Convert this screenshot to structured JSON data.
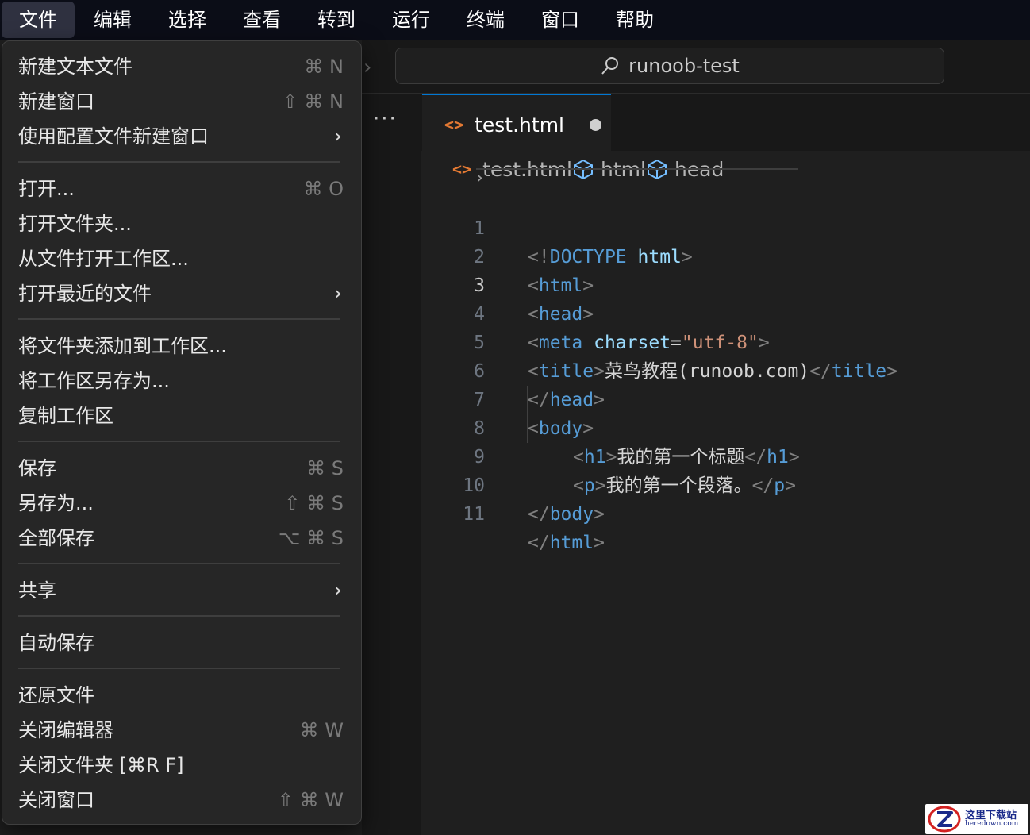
{
  "menubar": {
    "items": [
      "文件",
      "编辑",
      "选择",
      "查看",
      "转到",
      "运行",
      "终端",
      "窗口",
      "帮助"
    ]
  },
  "command_center": {
    "text": "runoob-test",
    "icon": "search-icon"
  },
  "more_actions": "···",
  "tab": {
    "label": "test.html",
    "dirty": true
  },
  "breadcrumb": {
    "file": "test.html",
    "node1": "html",
    "node2": "head"
  },
  "code": {
    "current_line": 3,
    "line_numbers": [
      "1",
      "2",
      "3",
      "4",
      "5",
      "6",
      "7",
      "8",
      "9",
      "10",
      "11"
    ],
    "tokens": {
      "lt": "<",
      "gt": ">",
      "close": "</",
      "bang": "!",
      "doctype": "DOCTYPE",
      "html": "html",
      "head": "head",
      "meta": "meta",
      "charset": "charset",
      "eq": "=",
      "charset_val": "\"utf-8\"",
      "title": "title",
      "title_text": "菜鸟教程(runoob.com)",
      "body": "body",
      "h1": "h1",
      "h1_text": "我的第一个标题",
      "p": "p",
      "p_text": "我的第一个段落。"
    }
  },
  "file_menu": {
    "new_text_file": "新建文本文件",
    "new_text_file_sc": "⌘ N",
    "new_window": "新建窗口",
    "new_window_sc": "⇧ ⌘ N",
    "new_window_profile": "使用配置文件新建窗口",
    "open": "打开...",
    "open_sc": "⌘ O",
    "open_folder": "打开文件夹...",
    "open_workspace": "从文件打开工作区...",
    "open_recent": "打开最近的文件",
    "add_folder": "将文件夹添加到工作区...",
    "save_workspace_as": "将工作区另存为...",
    "duplicate_workspace": "复制工作区",
    "save": "保存",
    "save_sc": "⌘ S",
    "save_as": "另存为...",
    "save_as_sc": "⇧ ⌘ S",
    "save_all": "全部保存",
    "save_all_sc": "⌥ ⌘ S",
    "share": "共享",
    "auto_save": "自动保存",
    "revert": "还原文件",
    "close_editor": "关闭编辑器",
    "close_editor_sc": "⌘ W",
    "close_folder": "关闭文件夹 [⌘R F]",
    "close_window": "关闭窗口",
    "close_window_sc": "⇧ ⌘ W",
    "chevron": "›"
  },
  "watermark": {
    "cn": "这里下载站",
    "en": "heredown.com"
  },
  "colors": {
    "accent": "#0078d4",
    "tag": "#569cd6",
    "attr": "#9cdcfe",
    "string": "#ce9178",
    "html_icon": "#e37933"
  }
}
